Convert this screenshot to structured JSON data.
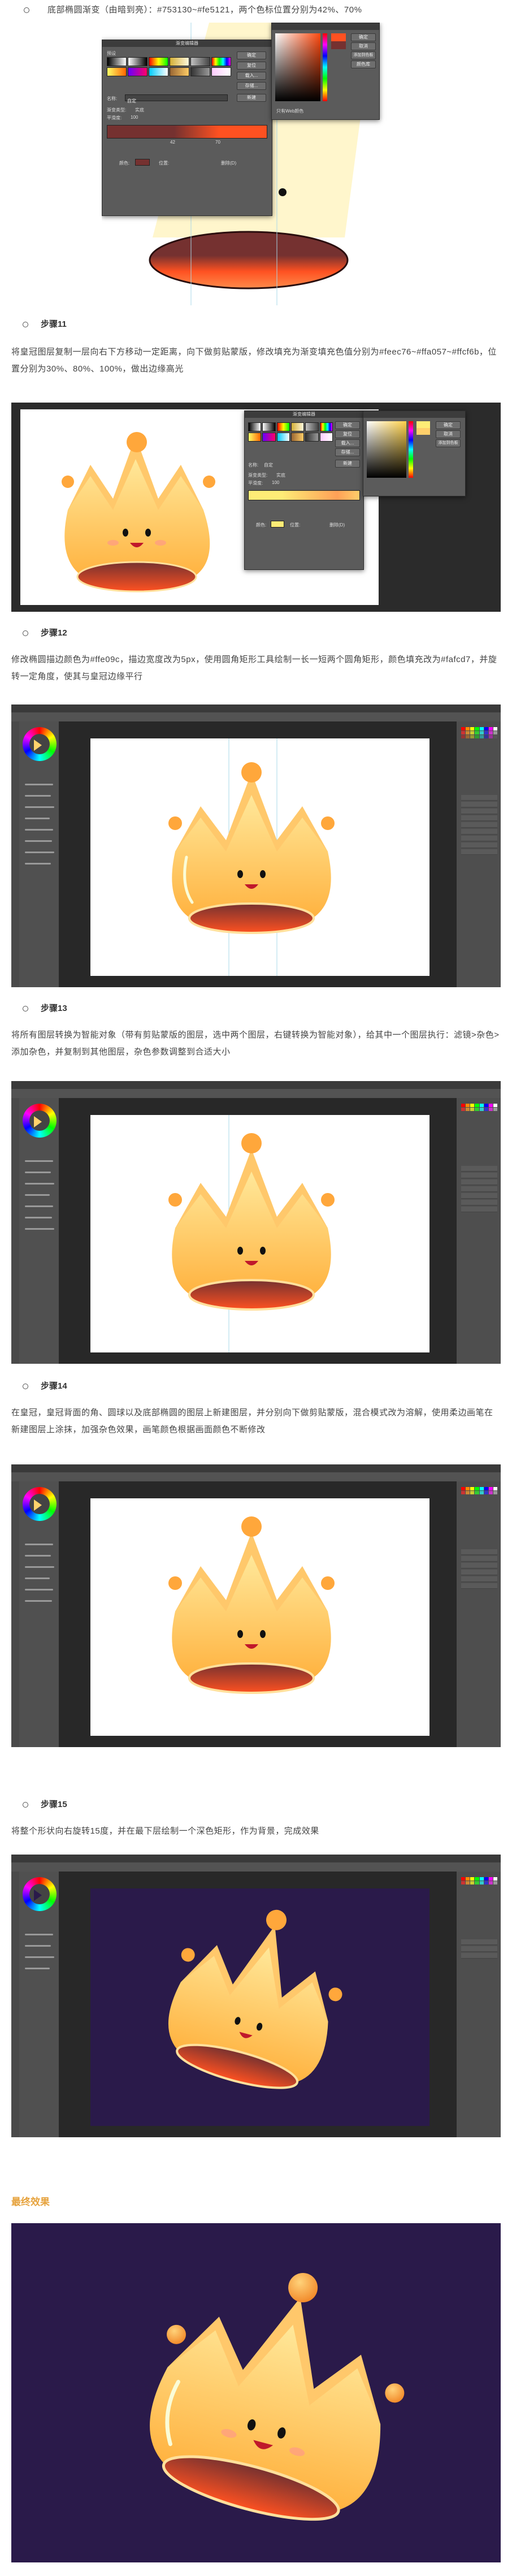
{
  "intro_text": "底部椭圆渐变（由暗到亮）：#753130~#fe5121，两个色标位置分别为42%、70%",
  "dialog_a": {
    "title": "渐变编辑器",
    "preset_label": "预设",
    "ok": "确定",
    "reset": "复位",
    "load": "载入...",
    "save": "存储...",
    "new": "新建",
    "name_label": "名称:",
    "name_value": "自定",
    "type_label": "渐变类型:",
    "type_value": "实底",
    "smooth_label": "平滑度:",
    "smooth_value": "100",
    "stop_value": "42",
    "stop_value2": "70",
    "color_label": "颜色:",
    "location_label": "位置:",
    "delete_label": "删除(D)",
    "picker_ok": "确定",
    "picker_cancel": "取消",
    "picker_add": "添加到色板",
    "picker_lib": "颜色库",
    "picker_web": "只有Web颜色"
  },
  "step11": {
    "title": "步骤11",
    "text": "将皇冠图层复制一层向右下方移动一定距离，向下做剪贴蒙版，修改填充为渐变填充色值分别为#feec76~#ffa057~#ffcf6b，位置分别为30%、80%、100%，做出边缘高光"
  },
  "dialog_b": {
    "title": "渐变编辑器",
    "ok": "确定",
    "reset": "复位",
    "load": "载入...",
    "save": "存储...",
    "new": "新建",
    "name_label": "名称:",
    "name_value": "自定",
    "type_label": "渐变类型:",
    "type_value": "实底",
    "smooth_label": "平滑度:",
    "smooth_value": "100",
    "color_label": "颜色:",
    "location_label": "位置:",
    "delete_label": "删除(D)",
    "picker_ok": "确定",
    "picker_cancel": "取消",
    "picker_add": "添加到色板"
  },
  "step12": {
    "title": "步骤12",
    "text": "修改椭圆描边颜色为#ffe09c，描边宽度改为5px，使用圆角矩形工具绘制一长一短两个圆角矩形，颜色填充改为#fafcd7，并旋转一定角度，使其与皇冠边缘平行"
  },
  "step13": {
    "title": "步骤13",
    "text": "将所有图层转换为智能对象（带有剪贴蒙版的图层，选中两个图层，右键转换为智能对象），给其中一个图层执行：滤镜>杂色>添加杂色，并复制到其他图层，杂色参数调整到合适大小"
  },
  "step14": {
    "title": "步骤14",
    "text": "在皇冠，皇冠背面的角、圆球以及底部椭圆的图层上新建图层，并分别向下做剪贴蒙版，混合模式改为溶解，使用柔边画笔在新建图层上涂抹，加强杂色效果，画笔颜色根据画面颜色不断修改"
  },
  "step15": {
    "title": "步骤15",
    "text": "将整个形状向右旋转15度，并在最下层绘制一个深色矩形，作为背景，完成效果"
  },
  "final_title": "最终效果",
  "colors": {
    "crown_light": "#feec76",
    "crown_mid": "#ffcf6b",
    "crown_dark": "#ffa057",
    "base_dark": "#753130",
    "base_light": "#fe5121",
    "stroke": "#ffe09c",
    "highlight": "#fafcd7",
    "final_bg": "#2a1a4a",
    "ps_dark": "#282828"
  }
}
